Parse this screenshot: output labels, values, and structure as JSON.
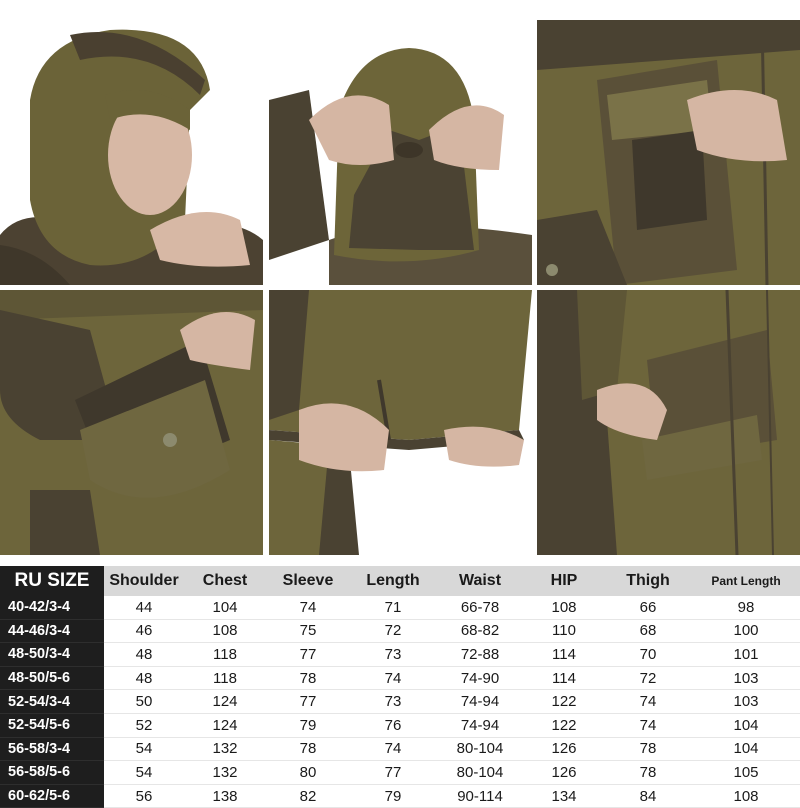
{
  "photos": [
    {
      "name": "photo-hood-front",
      "alt": "hood-front"
    },
    {
      "name": "photo-hood-back",
      "alt": "hood-back"
    },
    {
      "name": "photo-chest-pocket",
      "alt": "chest-pocket"
    },
    {
      "name": "photo-side-pocket",
      "alt": "side-pocket"
    },
    {
      "name": "photo-hem-drawstring",
      "alt": "hem-drawstring"
    },
    {
      "name": "photo-zip-pocket",
      "alt": "zip-pocket"
    }
  ],
  "colors": {
    "fabric_olive": "#6b6338",
    "fabric_dark": "#4a4030",
    "header_bg": "#d8d8d8",
    "label_bg": "#1e1e1e"
  },
  "size_table": {
    "headers": [
      "RU SIZE",
      "Shoulder",
      "Chest",
      "Sleeve",
      "Length",
      "Waist",
      "HIP",
      "Thigh",
      "Pant Length"
    ],
    "rows": [
      [
        "40-42/3-4",
        "44",
        "104",
        "74",
        "71",
        "66-78",
        "108",
        "66",
        "98"
      ],
      [
        "44-46/3-4",
        "46",
        "108",
        "75",
        "72",
        "68-82",
        "110",
        "68",
        "100"
      ],
      [
        "48-50/3-4",
        "48",
        "118",
        "77",
        "73",
        "72-88",
        "114",
        "70",
        "101"
      ],
      [
        "48-50/5-6",
        "48",
        "118",
        "78",
        "74",
        "74-90",
        "114",
        "72",
        "103"
      ],
      [
        "52-54/3-4",
        "50",
        "124",
        "77",
        "73",
        "74-94",
        "122",
        "74",
        "103"
      ],
      [
        "52-54/5-6",
        "52",
        "124",
        "79",
        "76",
        "74-94",
        "122",
        "74",
        "104"
      ],
      [
        "56-58/3-4",
        "54",
        "132",
        "78",
        "74",
        "80-104",
        "126",
        "78",
        "104"
      ],
      [
        "56-58/5-6",
        "54",
        "132",
        "80",
        "77",
        "80-104",
        "126",
        "78",
        "105"
      ],
      [
        "60-62/5-6",
        "56",
        "138",
        "82",
        "79",
        "90-114",
        "134",
        "84",
        "108"
      ]
    ]
  }
}
